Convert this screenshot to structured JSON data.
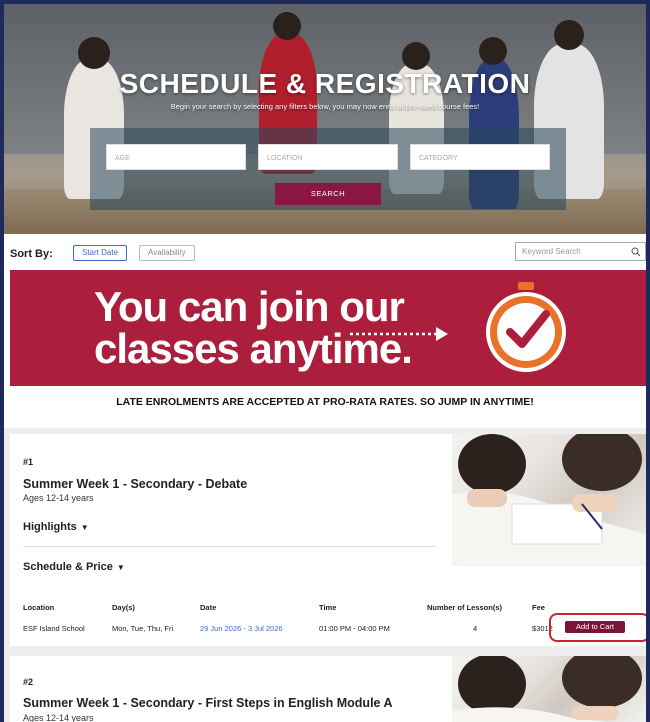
{
  "hero": {
    "title": "SCHEDULE & REGISTRATION",
    "subtitle": "Begin your search by selecting any filters below, you may now enrol at pro-rated course fees!",
    "filters": {
      "age_placeholder": "AGE",
      "location_placeholder": "LOCATION",
      "category_placeholder": "CATEGORY"
    },
    "search_label": "SEARCH"
  },
  "sort": {
    "label": "Sort By:",
    "options": [
      "Start Date",
      "Availability"
    ],
    "active": "Start Date",
    "keyword_placeholder": "Keyword Search"
  },
  "banner": {
    "line1": "You can join our",
    "line2": "classes anytime.",
    "note": "LATE ENROLMENTS ARE ACCEPTED AT PRO-RATA RATES. SO JUMP IN ANYTIME!"
  },
  "columns": [
    "Location",
    "Day(s)",
    "Date",
    "Time",
    "Number of Lesson(s)",
    "Fee"
  ],
  "courses": [
    {
      "number": "#1",
      "title": "Summer Week 1 - Secondary - Debate",
      "ages": "Ages 12-14 years",
      "highlights_label": "Highlights",
      "schedule_label": "Schedule & Price",
      "row": {
        "location": "ESF Island School",
        "days": "Mon, Tue, Thu, Fri",
        "date": "29 Jun 2026 - 3 Jul 2026",
        "time": "01:00 PM - 04:00 PM",
        "lessons": "4",
        "fee": "$3012",
        "cart_label": "Add to Cart"
      }
    },
    {
      "number": "#2",
      "title": "Summer Week 1 - Secondary - First Steps in English Module A",
      "ages": "Ages 12-14 years"
    }
  ],
  "colors": {
    "brand": "#ab1f3d",
    "button": "#8a1740",
    "link": "#3a6fd0",
    "highlight_ring": "#c8242f"
  }
}
